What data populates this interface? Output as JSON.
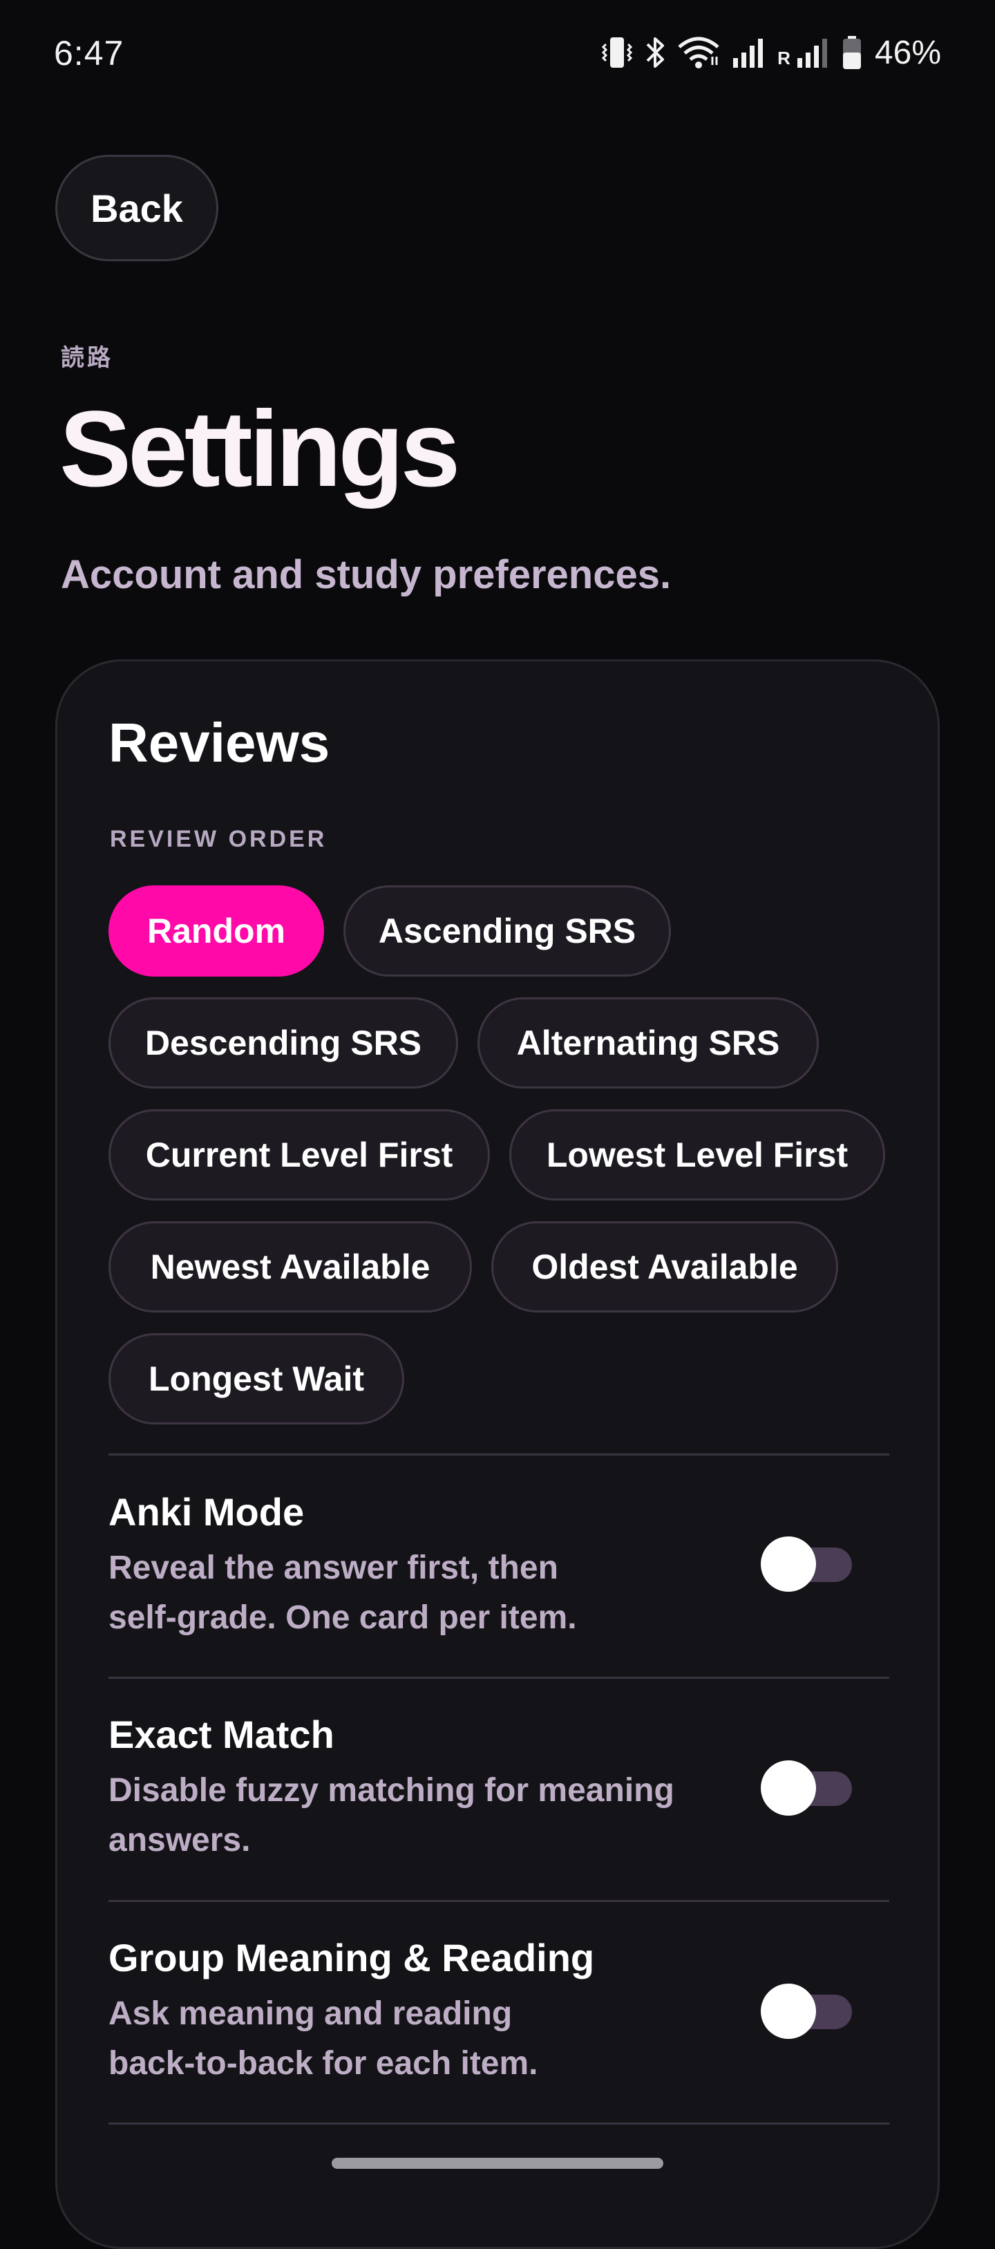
{
  "status_bar": {
    "time": "6:47",
    "roaming": "R",
    "battery_percent": "46%",
    "icons": [
      "vibrate-icon",
      "bluetooth-icon",
      "wifi-icon",
      "signal-icon",
      "signal-roaming-icon",
      "battery-icon"
    ]
  },
  "header": {
    "back_label": "Back",
    "kanji_label": "読路",
    "title": "Settings",
    "subtitle": "Account and study preferences."
  },
  "reviews": {
    "title": "Reviews",
    "order_label": "REVIEW ORDER",
    "order_options": [
      "Random",
      "Ascending SRS",
      "Descending SRS",
      "Alternating SRS",
      "Current Level First",
      "Lowest Level First",
      "Newest Available",
      "Oldest Available",
      "Longest Wait"
    ],
    "selected_order": "Random",
    "settings": [
      {
        "title": "Anki Mode",
        "description": "Reveal the answer first, then self-grade. One card per item.",
        "enabled": false
      },
      {
        "title": "Exact Match",
        "description": "Disable fuzzy matching for meaning answers.",
        "enabled": false
      },
      {
        "title": "Group Meaning & Reading",
        "description": "Ask meaning and reading back-to-back for each item.",
        "enabled": false
      }
    ]
  },
  "colors": {
    "accent": "#ff0aa8",
    "background": "#0a0a0d",
    "card": "#141317",
    "chip": "#1e1a22",
    "muted_text": "#bdaec6",
    "toggle_track_off": "#4a3d55"
  }
}
